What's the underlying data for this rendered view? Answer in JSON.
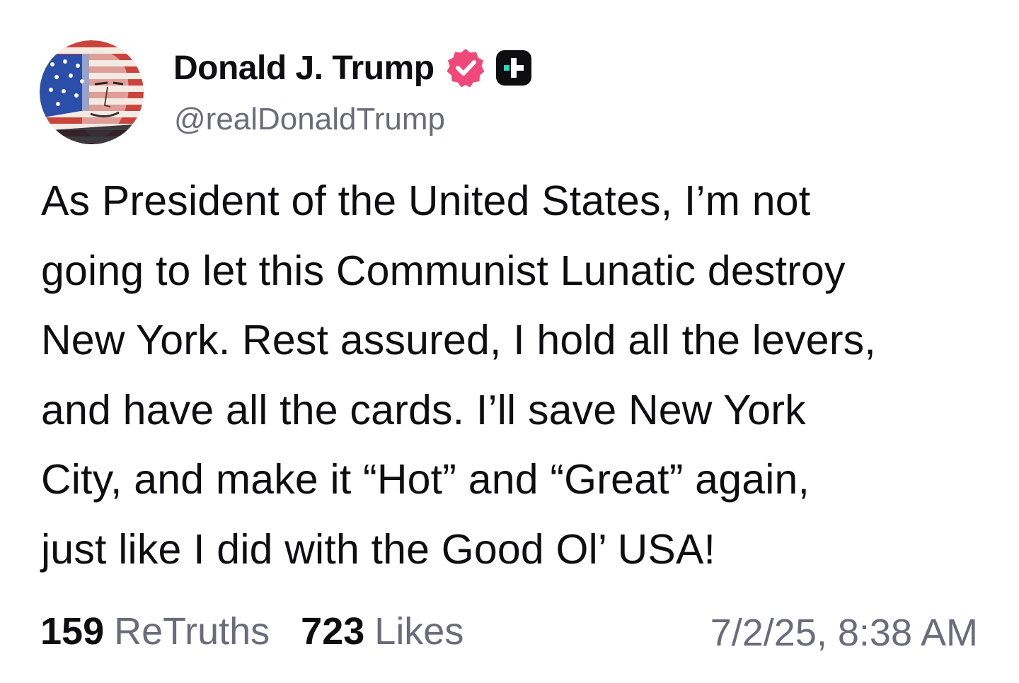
{
  "author": {
    "display_name": "Donald J. Trump",
    "handle": "@realDonaldTrump",
    "avatar_icon": "portrait-flag-avatar",
    "verified_icon": "verified-badge-icon",
    "verified_color": "#f0487a",
    "plus_icon": "plus-icon"
  },
  "post": {
    "lines": [
      "As President of the United States, I’m not",
      "going to let this Communist Lunatic destroy",
      "New York. Rest assured, I hold all the levers,",
      "and have all the cards. I’ll save New York",
      "City, and make it “Hot” and “Great” again,",
      "just like I did with the Good Ol’ USA!"
    ]
  },
  "stats": {
    "retruths_count": "159",
    "retruths_label": "ReTruths",
    "likes_count": "723",
    "likes_label": "Likes"
  },
  "timestamp": "7/2/25, 8:38 AM",
  "colors": {
    "text": "#0e0e11",
    "muted": "#6c6b7b",
    "badge": "#f0487a",
    "plus_bg": "#0e0e11",
    "plus_accent": "#2dd4bf"
  }
}
